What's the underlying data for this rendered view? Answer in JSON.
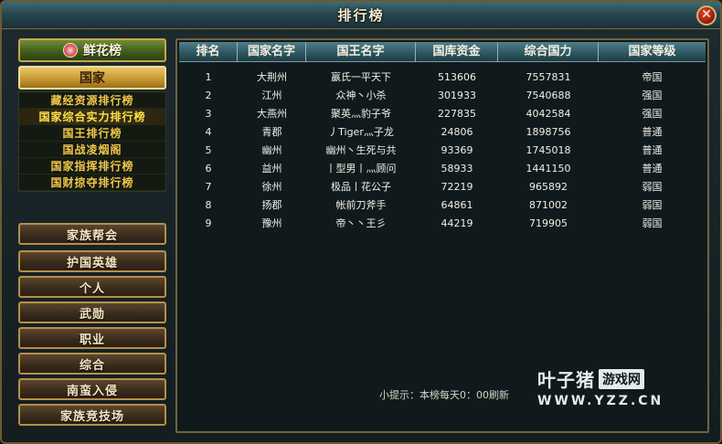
{
  "window": {
    "title": "排行榜",
    "close_label": "✕"
  },
  "sidebar": {
    "flower_tab": "鲜花榜",
    "country_button": "国家",
    "sub_items": [
      "藏经资源排行榜",
      "国家综合实力排行榜",
      "国王排行榜",
      "国战凌烟阁",
      "国家指挥排行榜",
      "国财掠夺排行榜"
    ],
    "categories": [
      "家族帮会",
      "护国英雄",
      "个人",
      "武勋",
      "职业",
      "综合",
      "南蛮入侵",
      "家族竞技场"
    ]
  },
  "table": {
    "headers": [
      "排名",
      "国家名字",
      "国王名字",
      "国库资金",
      "综合国力",
      "国家等级"
    ],
    "rows": [
      [
        "1",
        "大荆州",
        "嬴氏一平天下",
        "513606",
        "7557831",
        "帝国"
      ],
      [
        "2",
        "江州",
        "众神丶小杀",
        "301933",
        "7540688",
        "强国"
      ],
      [
        "3",
        "大燕州",
        "聚英灬豹子爷",
        "227835",
        "4042584",
        "强国"
      ],
      [
        "4",
        "青郡",
        "丿Tiger灬子龙",
        "24806",
        "1898756",
        "普通"
      ],
      [
        "5",
        "幽州",
        "幽州丶生死与共",
        "93369",
        "1745018",
        "普通"
      ],
      [
        "6",
        "益州",
        "丨型男丨灬顾问",
        "58933",
        "1441150",
        "普通"
      ],
      [
        "7",
        "徐州",
        "极品丨花公子",
        "72219",
        "965892",
        "弱国"
      ],
      [
        "8",
        "扬郡",
        "帐前刀斧手",
        "64861",
        "871002",
        "弱国"
      ],
      [
        "9",
        "豫州",
        "帝丶丶王彡",
        "44219",
        "719905",
        "弱国"
      ]
    ]
  },
  "tip": "小提示：本榜每天0：00刷新",
  "watermark": {
    "name": "叶子猪",
    "tag": "游戏网",
    "url": "WWW.YZZ.CN"
  }
}
